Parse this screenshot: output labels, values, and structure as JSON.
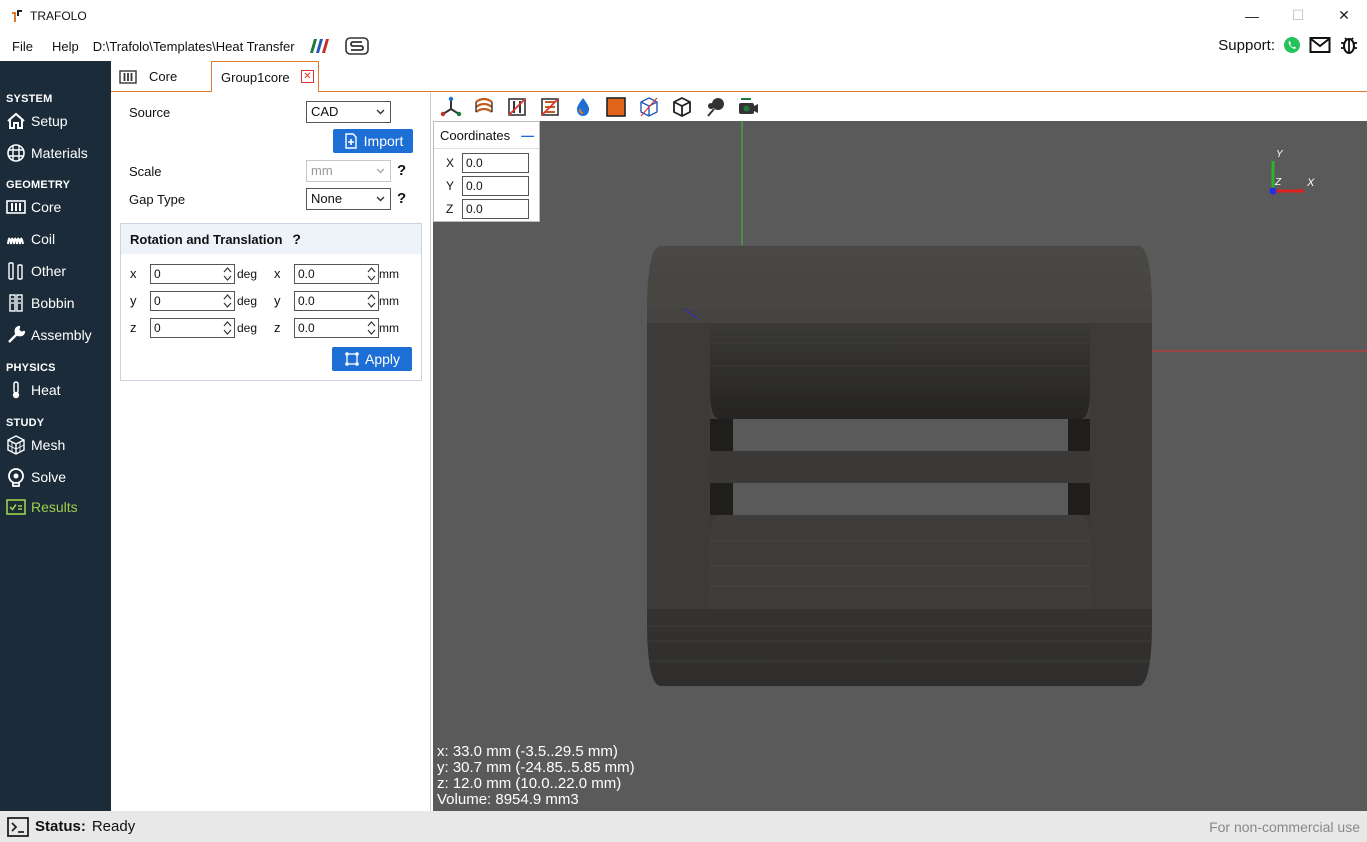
{
  "window": {
    "title": "TRAFOLO",
    "minimize": "—",
    "maximize": "☐",
    "close": "✕"
  },
  "menu": {
    "file": "File",
    "help": "Help",
    "path": "D:\\Trafolo\\Templates\\Heat Transfer",
    "support": "Support:"
  },
  "sidebar": {
    "system": "SYSTEM",
    "setup": "Setup",
    "materials": "Materials",
    "geometry": "GEOMETRY",
    "core": "Core",
    "coil": "Coil",
    "other": "Other",
    "bobbin": "Bobbin",
    "assembly": "Assembly",
    "physics": "PHYSICS",
    "heat": "Heat",
    "study": "STUDY",
    "mesh": "Mesh",
    "solve": "Solve",
    "results": "Results"
  },
  "tabs": {
    "core": "Core",
    "group": "Group1core"
  },
  "panel": {
    "source_label": "Source",
    "source_value": "CAD",
    "import": "Import",
    "scale_label": "Scale",
    "scale_value": "mm",
    "gap_label": "Gap Type",
    "gap_value": "None",
    "help": "?",
    "rt_title": "Rotation and Translation",
    "rot_x": "0",
    "rot_y": "0",
    "rot_z": "0",
    "tr_x": "0.0",
    "tr_y": "0.0",
    "tr_z": "0.0",
    "lbl_x": "x",
    "lbl_y": "y",
    "lbl_z": "z",
    "deg": "deg",
    "mm": "mm",
    "apply": "Apply"
  },
  "coords": {
    "title": "Coordinates",
    "minus": "—",
    "X": "0.0",
    "Y": "0.0",
    "Z": "0.0",
    "lx": "X",
    "ly": "Y",
    "lz": "Z"
  },
  "axes": {
    "y": "Y",
    "z": "Z",
    "x": "X"
  },
  "info": {
    "x": "x: 33.0 mm (-3.5..29.5 mm)",
    "y": "y: 30.7 mm (-24.85..5.85 mm)",
    "z": "z: 12.0 mm (10.0..22.0 mm)",
    "volume": "Volume: 8954.9 mm3"
  },
  "status": {
    "label": "Status:",
    "value": "Ready",
    "license": "For non-commercial use"
  },
  "colors": {
    "accent": "#e07a2c",
    "sidebar": "#1c2b3a",
    "button": "#1d6fd6",
    "active": "#9bd14a"
  }
}
